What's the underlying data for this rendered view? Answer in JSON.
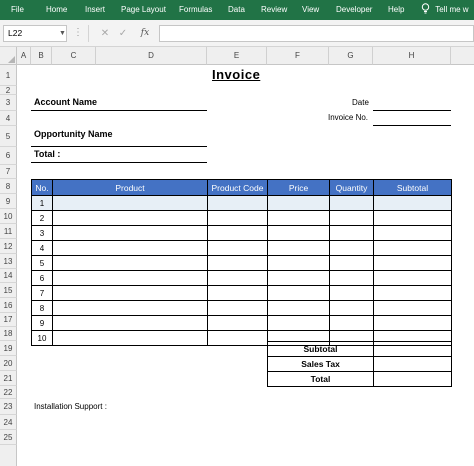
{
  "ribbon": {
    "tabs": [
      "File",
      "Home",
      "Insert",
      "Page Layout",
      "Formulas",
      "Data",
      "Review",
      "View",
      "Developer",
      "Help"
    ],
    "tell_me": "Tell me w",
    "color": "#217346"
  },
  "formula_bar": {
    "name_box": "L22",
    "cancel_glyph": "✕",
    "enter_glyph": "✓",
    "fx_label": "fx",
    "formula": ""
  },
  "columns": [
    "A",
    "B",
    "C",
    "D",
    "E",
    "F",
    "G",
    "H"
  ],
  "rows": [
    "1",
    "2",
    "3",
    "4",
    "5",
    "6",
    "7",
    "8",
    "9",
    "10",
    "11",
    "12",
    "13",
    "14",
    "15",
    "16",
    "17",
    "18",
    "19",
    "20",
    "21",
    "22",
    "23",
    "24",
    "25"
  ],
  "invoice": {
    "title": "Invoice",
    "account_name_label": "Account Name",
    "opportunity_name_label": "Opportunity Name",
    "total_label": "Total :",
    "date_label": "Date",
    "invoice_no_label": "Invoice No.",
    "installation_support_label": "Installation Support :"
  },
  "items_table": {
    "header_color": "#4472c4",
    "headers": [
      "No.",
      "Product",
      "Product Code",
      "Price",
      "Quantity",
      "Subtotal"
    ],
    "rows": [
      {
        "no": "1"
      },
      {
        "no": "2"
      },
      {
        "no": "3"
      },
      {
        "no": "4"
      },
      {
        "no": "5"
      },
      {
        "no": "6"
      },
      {
        "no": "7"
      },
      {
        "no": "8"
      },
      {
        "no": "9"
      },
      {
        "no": "10"
      }
    ]
  },
  "totals": {
    "subtotal_label": "Subtotal",
    "sales_tax_label": "Sales Tax",
    "total_label": "Total"
  }
}
